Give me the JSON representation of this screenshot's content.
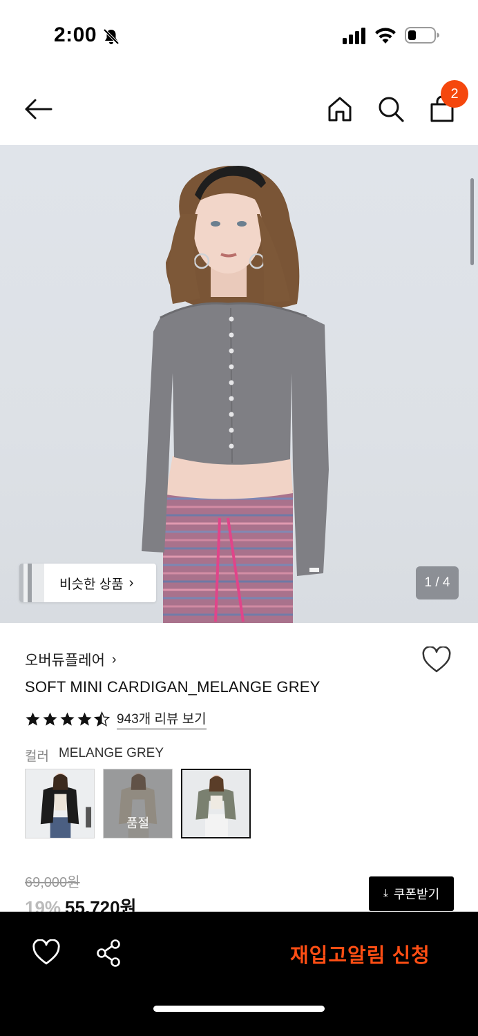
{
  "status": {
    "time": "2:00"
  },
  "header": {
    "cart_count": "2"
  },
  "hero": {
    "similar_label": "비슷한 상품",
    "page_counter": "1 / 4"
  },
  "product": {
    "brand": "오버듀플레어",
    "title": "SOFT MINI CARDIGAN_MELANGE GREY",
    "rating": 4.5,
    "review_link": "943개 리뷰 보기",
    "color_label": "컬러",
    "color_value": "MELANGE GREY",
    "swatches": [
      {
        "color": "black",
        "soldout": false,
        "selected": false
      },
      {
        "color": "beige",
        "soldout": true,
        "soldout_label": "품절",
        "selected": false
      },
      {
        "color": "melange grey",
        "soldout": false,
        "selected": true
      }
    ],
    "price_original": "69,000원",
    "discount": "19%",
    "price_final": "55,720원",
    "coupon_label": "쿠폰받기"
  },
  "bottom": {
    "restock_label": "재입고알림 신청"
  },
  "colors": {
    "accent": "#f5470d",
    "restock": "#ff4e14"
  }
}
